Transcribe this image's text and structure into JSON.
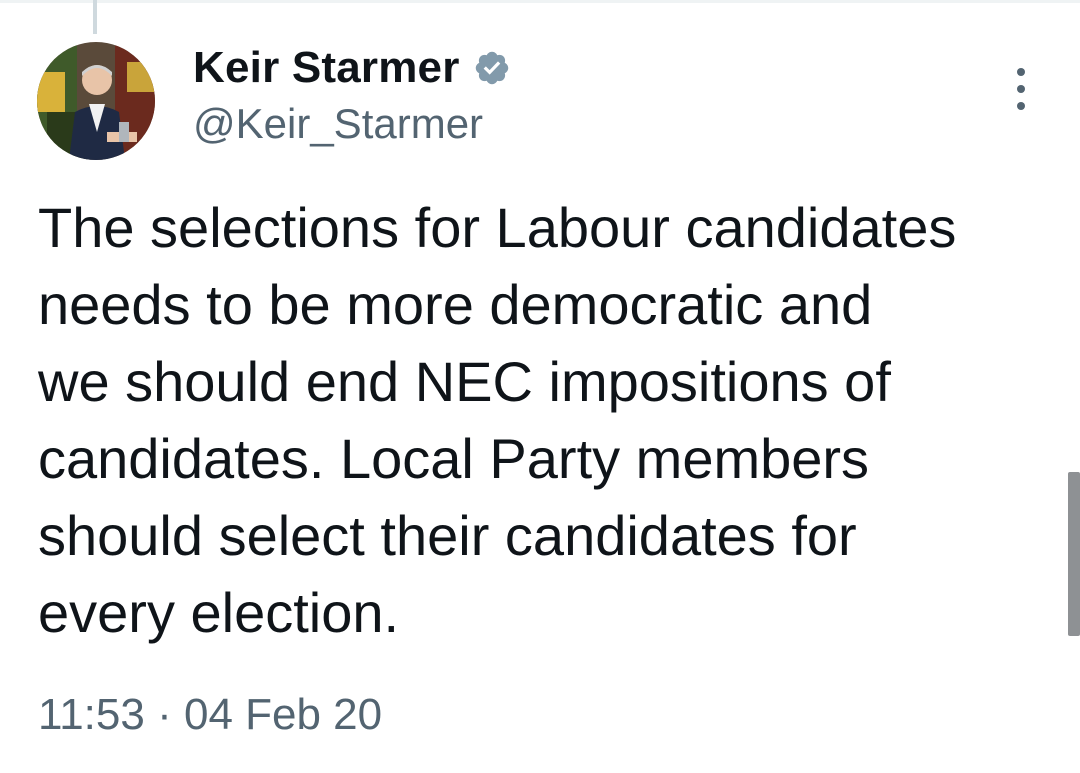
{
  "tweet": {
    "author": {
      "display_name": "Keir Starmer",
      "handle": "@Keir_Starmer",
      "verified": true,
      "verified_color": "#829aab"
    },
    "text": "The selections for Labour candidates\nneeds to be more democratic and\nwe should end NEC impositions of\ncandidates. Local Party members\nshould select their candidates for\nevery election.",
    "time": "11:53",
    "separator": "·",
    "date": "04 Feb 20"
  },
  "icons": {
    "more": "more-vertical-icon",
    "verified": "verified-badge-icon"
  },
  "colors": {
    "text_primary": "#0f1419",
    "text_secondary": "#536471",
    "background": "#ffffff"
  }
}
